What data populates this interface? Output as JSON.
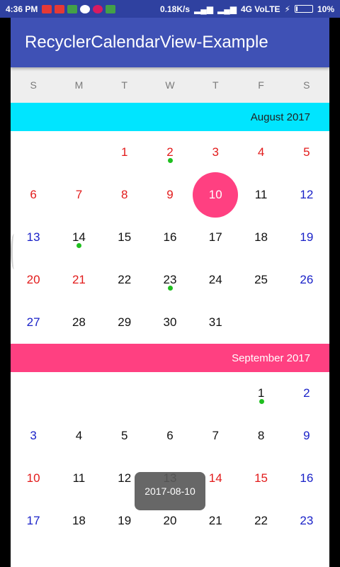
{
  "status_bar": {
    "time": "4:36 PM",
    "network": "0.18K/s",
    "carrier": "4G VoLTE",
    "battery": "10%",
    "battery_level": 0.1
  },
  "app_bar": {
    "title": "RecyclerCalendarView-Example"
  },
  "weekdays": [
    "S",
    "M",
    "T",
    "W",
    "T",
    "F",
    "S"
  ],
  "months": [
    {
      "label": "August 2017",
      "color": "#00e5ff",
      "weeks": [
        [
          {
            "d": "",
            "c": ""
          },
          {
            "d": "",
            "c": ""
          },
          {
            "d": "1",
            "c": "red"
          },
          {
            "d": "2",
            "c": "red",
            "dot": true
          },
          {
            "d": "3",
            "c": "red"
          },
          {
            "d": "4",
            "c": "red"
          },
          {
            "d": "5",
            "c": "red"
          }
        ],
        [
          {
            "d": "6",
            "c": "red"
          },
          {
            "d": "7",
            "c": "red"
          },
          {
            "d": "8",
            "c": "red"
          },
          {
            "d": "9",
            "c": "red"
          },
          {
            "d": "10",
            "c": "black",
            "selected": true
          },
          {
            "d": "11",
            "c": "black"
          },
          {
            "d": "12",
            "c": "blue"
          }
        ],
        [
          {
            "d": "13",
            "c": "blue"
          },
          {
            "d": "14",
            "c": "black",
            "dot": true
          },
          {
            "d": "15",
            "c": "black"
          },
          {
            "d": "16",
            "c": "black"
          },
          {
            "d": "17",
            "c": "black"
          },
          {
            "d": "18",
            "c": "black"
          },
          {
            "d": "19",
            "c": "blue"
          }
        ],
        [
          {
            "d": "20",
            "c": "red"
          },
          {
            "d": "21",
            "c": "red"
          },
          {
            "d": "22",
            "c": "black"
          },
          {
            "d": "23",
            "c": "black",
            "dot": true
          },
          {
            "d": "24",
            "c": "black"
          },
          {
            "d": "25",
            "c": "black"
          },
          {
            "d": "26",
            "c": "blue"
          }
        ],
        [
          {
            "d": "27",
            "c": "blue"
          },
          {
            "d": "28",
            "c": "black"
          },
          {
            "d": "29",
            "c": "black"
          },
          {
            "d": "30",
            "c": "black"
          },
          {
            "d": "31",
            "c": "black"
          },
          {
            "d": "",
            "c": ""
          },
          {
            "d": "",
            "c": ""
          }
        ]
      ]
    },
    {
      "label": "September 2017",
      "color": "#ff4081",
      "weeks": [
        [
          {
            "d": "",
            "c": ""
          },
          {
            "d": "",
            "c": ""
          },
          {
            "d": "",
            "c": ""
          },
          {
            "d": "",
            "c": ""
          },
          {
            "d": "",
            "c": ""
          },
          {
            "d": "1",
            "c": "black",
            "dot": true
          },
          {
            "d": "2",
            "c": "blue"
          }
        ],
        [
          {
            "d": "3",
            "c": "blue"
          },
          {
            "d": "4",
            "c": "black"
          },
          {
            "d": "5",
            "c": "black"
          },
          {
            "d": "6",
            "c": "black"
          },
          {
            "d": "7",
            "c": "black"
          },
          {
            "d": "8",
            "c": "black"
          },
          {
            "d": "9",
            "c": "blue"
          }
        ],
        [
          {
            "d": "10",
            "c": "red"
          },
          {
            "d": "11",
            "c": "black"
          },
          {
            "d": "12",
            "c": "black"
          },
          {
            "d": "13",
            "c": "black"
          },
          {
            "d": "14",
            "c": "red"
          },
          {
            "d": "15",
            "c": "red"
          },
          {
            "d": "16",
            "c": "blue"
          }
        ],
        [
          {
            "d": "17",
            "c": "blue"
          },
          {
            "d": "18",
            "c": "black"
          },
          {
            "d": "19",
            "c": "black"
          },
          {
            "d": "20",
            "c": "black"
          },
          {
            "d": "21",
            "c": "black"
          },
          {
            "d": "22",
            "c": "black"
          },
          {
            "d": "23",
            "c": "blue"
          }
        ]
      ]
    }
  ],
  "toast": "2017-08-10",
  "colors": {
    "primary": "#3f51b5",
    "accent": "#ff4081",
    "august_header": "#00e5ff",
    "weekend_red": "#e21b1b",
    "weekend_blue": "#1a22c8",
    "event_dot": "#1fbf1f"
  }
}
